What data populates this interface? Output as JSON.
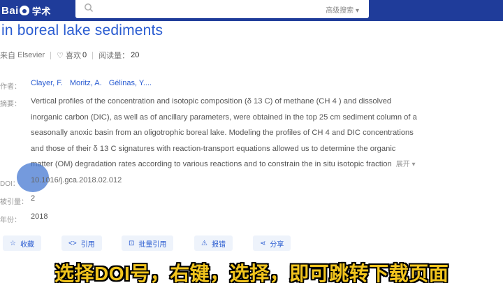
{
  "header": {
    "logo_text": "Bai",
    "logo_suffix": "学术",
    "search_value": "",
    "advanced_search": "高级搜索 ▾"
  },
  "paper": {
    "title": "in boreal lake sediments",
    "source_prefix": "来自",
    "source": "Elsevier",
    "likes_label": "喜欢",
    "likes": "0",
    "reads_label": "阅读量：",
    "reads": "20",
    "authors_label": "作者：",
    "authors": [
      "Clayer, F.",
      "Moritz, A.",
      "Gélinas, Y...."
    ],
    "abstract_label": "摘要：",
    "abstract_lines": [
      "Vertical profiles of the concentration and isotopic composition (δ 13 C) of methane (CH 4 ) and dissolved",
      "inorganic carbon (DIC), as well as of ancillary parameters, were obtained in the top 25 cm sediment column of a",
      "seasonally anoxic basin from an oligotrophic boreal lake. Modeling the profiles of CH 4 and DIC concentrations",
      "and those of their δ 13 C signatures with reaction-transport equations allowed us to determine the organic",
      "matter (OM) degradation rates according to various reactions and to constrain the in situ isotopic fraction"
    ],
    "expand": "展开 ▾",
    "doi_label": "DOI：",
    "doi": "10.1016/j.gca.2018.02.012",
    "cited_label": "被引量：",
    "cited": "2",
    "year_label": "年份：",
    "year": "2018"
  },
  "actions": [
    {
      "icon": "☆",
      "label": "收藏"
    },
    {
      "icon": "<>",
      "label": "引用"
    },
    {
      "icon": "⊡",
      "label": "批量引用"
    },
    {
      "icon": "⚠",
      "label": "报错"
    },
    {
      "icon": "⋖",
      "label": "分享"
    }
  ],
  "caption": "选择DOI号，右键，选择，即可跳转下载页面"
}
